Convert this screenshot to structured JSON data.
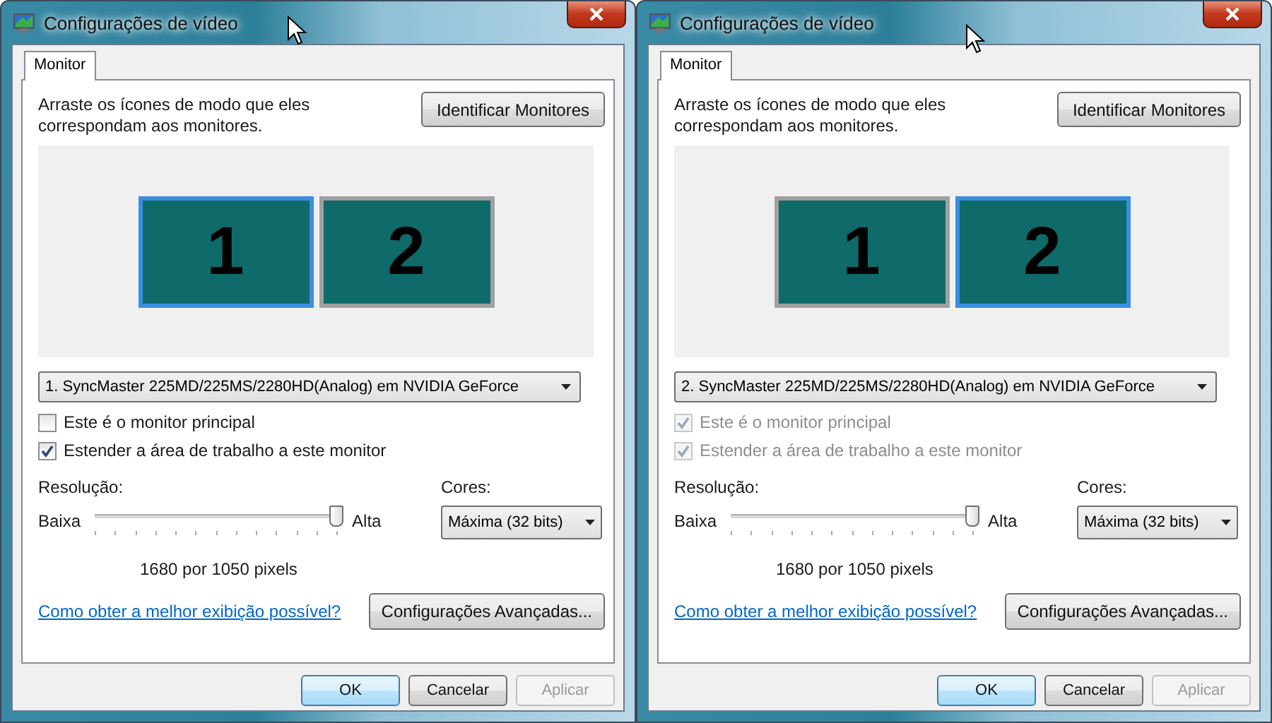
{
  "windows": [
    {
      "title": "Configurações de vídeo",
      "tabs": [
        {
          "label": "Monitor",
          "selected": true
        }
      ],
      "instructions": "Arraste os ícones de modo que eles correspondam aos monitores.",
      "identify_button": "Identificar Monitores",
      "monitors": [
        {
          "label": "1",
          "selected": true
        },
        {
          "label": "2",
          "selected": false
        }
      ],
      "display_dropdown": {
        "value": "1. SyncMaster 225MD/225MS/2280HD(Analog) em NVIDIA GeForce"
      },
      "checkboxes": [
        {
          "label": "Este é o monitor principal",
          "checked": false,
          "disabled": false
        },
        {
          "label": "Estender a área de trabalho a este monitor",
          "checked": true,
          "disabled": false
        }
      ],
      "resolution": {
        "label": "Resolução:",
        "low": "Baixa",
        "high": "Alta",
        "level": 1,
        "reading": "1680 por 1050 pixels"
      },
      "colors": {
        "label": "Cores:",
        "value": "Máxima (32 bits)"
      },
      "help_link": "Como obter a melhor exibição possível?",
      "advanced_button": "Configurações Avançadas...",
      "buttons": [
        {
          "label": "OK",
          "disabled": false,
          "default": true
        },
        {
          "label": "Cancelar",
          "disabled": false,
          "default": false
        },
        {
          "label": "Aplicar",
          "disabled": true,
          "default": false
        }
      ]
    },
    {
      "title": "Configurações de vídeo",
      "tabs": [
        {
          "label": "Monitor",
          "selected": true
        }
      ],
      "instructions": "Arraste os ícones de modo que eles correspondam aos monitores.",
      "identify_button": "Identificar Monitores",
      "monitors": [
        {
          "label": "1",
          "selected": false
        },
        {
          "label": "2",
          "selected": true
        }
      ],
      "display_dropdown": {
        "value": "2. SyncMaster 225MD/225MS/2280HD(Analog) em NVIDIA GeForce"
      },
      "checkboxes": [
        {
          "label": "Este é o monitor principal",
          "checked": true,
          "disabled": true
        },
        {
          "label": "Estender a área de trabalho a este monitor",
          "checked": true,
          "disabled": true
        }
      ],
      "resolution": {
        "label": "Resolução:",
        "low": "Baixa",
        "high": "Alta",
        "level": 1,
        "reading": "1680 por 1050 pixels"
      },
      "colors": {
        "label": "Cores:",
        "value": "Máxima (32 bits)"
      },
      "help_link": "Como obter a melhor exibição possível?",
      "advanced_button": "Configurações Avançadas...",
      "buttons": [
        {
          "label": "OK",
          "disabled": false,
          "default": true
        },
        {
          "label": "Cancelar",
          "disabled": false,
          "default": false
        },
        {
          "label": "Aplicar",
          "disabled": true,
          "default": false
        }
      ]
    }
  ]
}
